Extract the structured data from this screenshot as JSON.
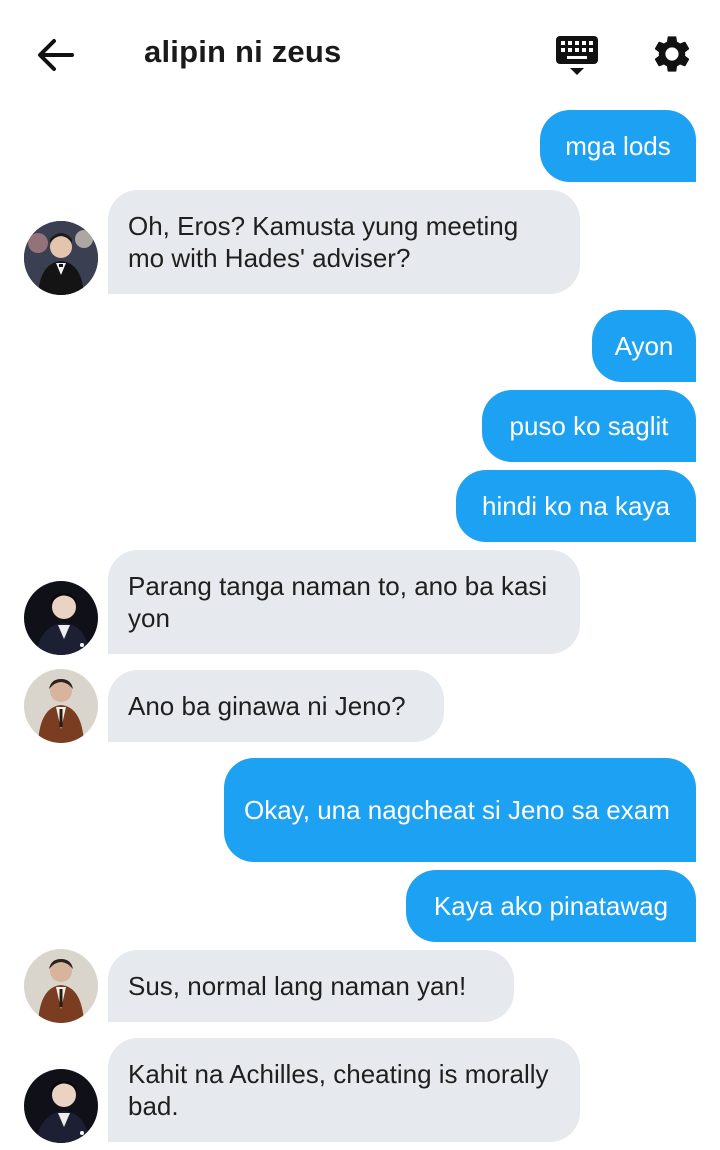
{
  "header": {
    "title": "alipin ni zeus",
    "back_icon": "arrow-left-icon",
    "keyboard_icon": "keyboard-icon",
    "settings_icon": "gear-icon"
  },
  "colors": {
    "outgoing_bubble": "#1da1f2",
    "incoming_bubble": "#e6e9ed"
  },
  "messages": [
    {
      "side": "out",
      "text": "mga lods"
    },
    {
      "side": "in",
      "avatar": "avatar-a",
      "text": "Oh, Eros? Kamusta yung meeting mo with Hades' adviser?"
    },
    {
      "side": "out",
      "text": "Ayon"
    },
    {
      "side": "out",
      "text": "puso ko saglit"
    },
    {
      "side": "out",
      "text": "hindi ko na kaya"
    },
    {
      "side": "in",
      "avatar": "avatar-b",
      "text": "Parang tanga naman to, ano ba kasi yon"
    },
    {
      "side": "in",
      "avatar": "avatar-c",
      "text": "Ano ba ginawa ni Jeno?"
    },
    {
      "side": "out",
      "text": "Okay, una nagcheat si Jeno sa exam"
    },
    {
      "side": "out",
      "text": "Kaya ako pinatawag"
    },
    {
      "side": "in",
      "avatar": "avatar-c",
      "text": "Sus, normal lang naman yan!"
    },
    {
      "side": "in",
      "avatar": "avatar-b",
      "text": "Kahit na Achilles, cheating is morally bad."
    }
  ]
}
